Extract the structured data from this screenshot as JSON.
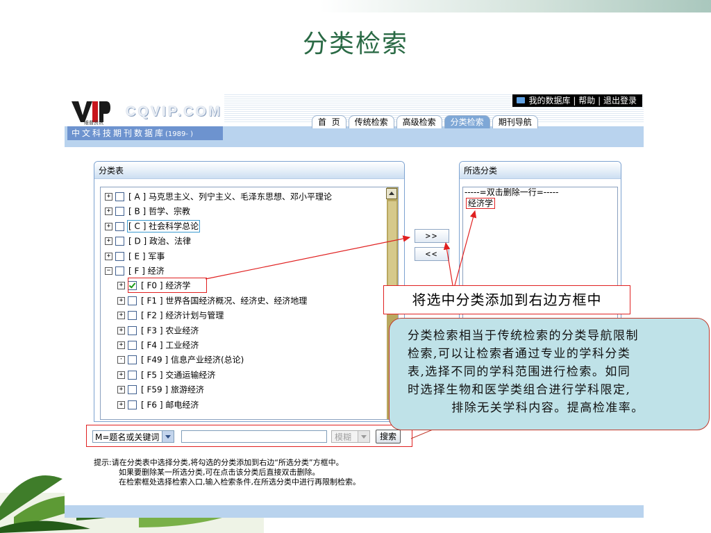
{
  "slide": {
    "title": "分类检索"
  },
  "app": {
    "logo": {
      "brand": "VIP",
      "sub": "维普资讯",
      "site": "CQVIP.COM",
      "db_name": "中文科技期刊数据库",
      "db_years": "(1989- )"
    },
    "top_links": [
      "我的数据库",
      "|",
      "帮助",
      "|",
      "退出登录"
    ],
    "nav_tabs": [
      {
        "label": "首  页",
        "active": false
      },
      {
        "label": "传统检索",
        "active": false
      },
      {
        "label": "高级检索",
        "active": false
      },
      {
        "label": "分类检索",
        "active": true
      },
      {
        "label": "期刊导航",
        "active": false
      }
    ],
    "tree_panel_title": "分类表",
    "selected_panel_title": "所选分类",
    "tree": [
      {
        "expander": "+",
        "checked": false,
        "code": "A",
        "label": "[ A ] 马克思主义、列宁主义、毛泽东思想、邓小平理论",
        "level": 0
      },
      {
        "expander": "+",
        "checked": false,
        "code": "B",
        "label": "[ B ] 哲学、宗教",
        "level": 0
      },
      {
        "expander": "+",
        "checked": false,
        "code": "C",
        "label": "[ C ] 社会科学总论",
        "level": 0
      },
      {
        "expander": "+",
        "checked": false,
        "code": "D",
        "label": "[ D ] 政治、法律",
        "level": 0
      },
      {
        "expander": "+",
        "checked": false,
        "code": "E",
        "label": "[ E ] 军事",
        "level": 0
      },
      {
        "expander": "−",
        "checked": false,
        "code": "F",
        "label": "[ F ] 经济",
        "level": 0
      },
      {
        "expander": "+",
        "checked": true,
        "code": "F0",
        "label": "[ F0 ] 经济学",
        "level": 1
      },
      {
        "expander": "+",
        "checked": false,
        "code": "F1",
        "label": "[ F1 ] 世界各国经济概况、经济史、经济地理",
        "level": 1
      },
      {
        "expander": "+",
        "checked": false,
        "code": "F2",
        "label": "[ F2 ] 经济计划与管理",
        "level": 1
      },
      {
        "expander": "+",
        "checked": false,
        "code": "F3",
        "label": "[ F3 ] 农业经济",
        "level": 1
      },
      {
        "expander": "+",
        "checked": false,
        "code": "F4",
        "label": "[ F4 ] 工业经济",
        "level": 1
      },
      {
        "expander": "·",
        "checked": false,
        "code": "F49",
        "label": "[ F49 ] 信息产业经济(总论)",
        "level": 1
      },
      {
        "expander": "+",
        "checked": false,
        "code": "F5",
        "label": "[ F5 ] 交通运输经济",
        "level": 1
      },
      {
        "expander": "+",
        "checked": false,
        "code": "F59",
        "label": "[ F59 ] 旅游经济",
        "level": 1
      },
      {
        "expander": "+",
        "checked": false,
        "code": "F6",
        "label": "[ F6 ] 邮电经济",
        "level": 1
      }
    ],
    "move_right_label": ">>",
    "move_left_label": "<<",
    "selected_header_line": "-----=双击删除一行=-----",
    "selected_items": [
      "经济学"
    ],
    "search": {
      "field_value": "M=题名或关键词",
      "keyword_value": "",
      "mode_value": "模糊",
      "button_label": "搜索"
    },
    "hint_lines": [
      "提示:请在分类表中选择分类,将勾选的分类添加到右边“所选分类”方框中。",
      "如果要删除某一所选分类,可在点击该分类后直接双击删除。",
      "在检索框处选择检索入口,输入检索条件,在所选分类中进行再限制检索。"
    ]
  },
  "annotations": {
    "callout_label": "将选中分类添加到右边方框中",
    "note_lines": [
      "分类检索相当于传统检索的分类导航限制",
      "检索,可以让检索者通过专业的学科分类",
      "表,选择不同的学科范围进行检索。如同",
      "时选择生物和医学类组合进行学科限定,",
      "排除无关学科内容。提高检准率。"
    ],
    "arrow_color": "#e02020"
  }
}
